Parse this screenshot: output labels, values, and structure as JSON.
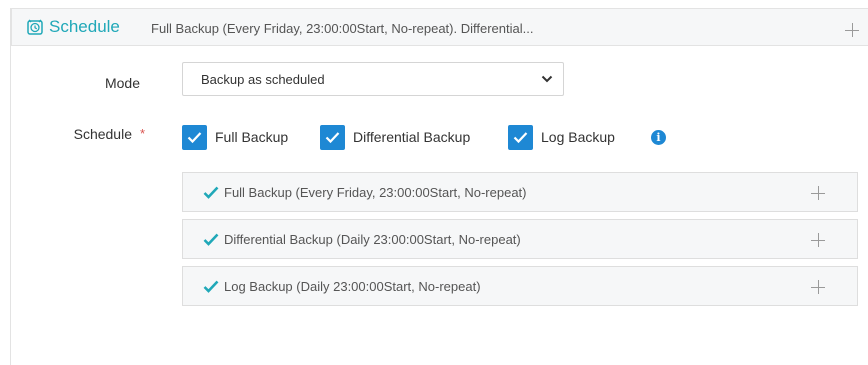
{
  "header": {
    "icon": "clock-icon",
    "title": "Schedule",
    "summary": "Full Backup (Every Friday, 23:00:00Start, No-repeat). Differential...",
    "expand_icon": "plus-icon"
  },
  "form": {
    "mode": {
      "label": "Mode",
      "value": "Backup as scheduled"
    },
    "schedule": {
      "label": "Schedule",
      "required_mark": "*",
      "options": [
        {
          "label": "Full Backup",
          "checked": true
        },
        {
          "label": "Differential Backup",
          "checked": true
        },
        {
          "label": "Log Backup",
          "checked": true
        }
      ],
      "info_icon": "info-icon"
    },
    "sections": [
      {
        "text": "Full Backup (Every Friday, 23:00:00Start, No-repeat)"
      },
      {
        "text": "Differential Backup (Daily 23:00:00Start, No-repeat)"
      },
      {
        "text": "Log Backup (Daily 23:00:00Start, No-repeat)"
      }
    ]
  },
  "colors": {
    "accent": "#20a8b8",
    "checkbox": "#1e88d4",
    "check_mark": "#20a8b8",
    "required": "#d9534f"
  }
}
